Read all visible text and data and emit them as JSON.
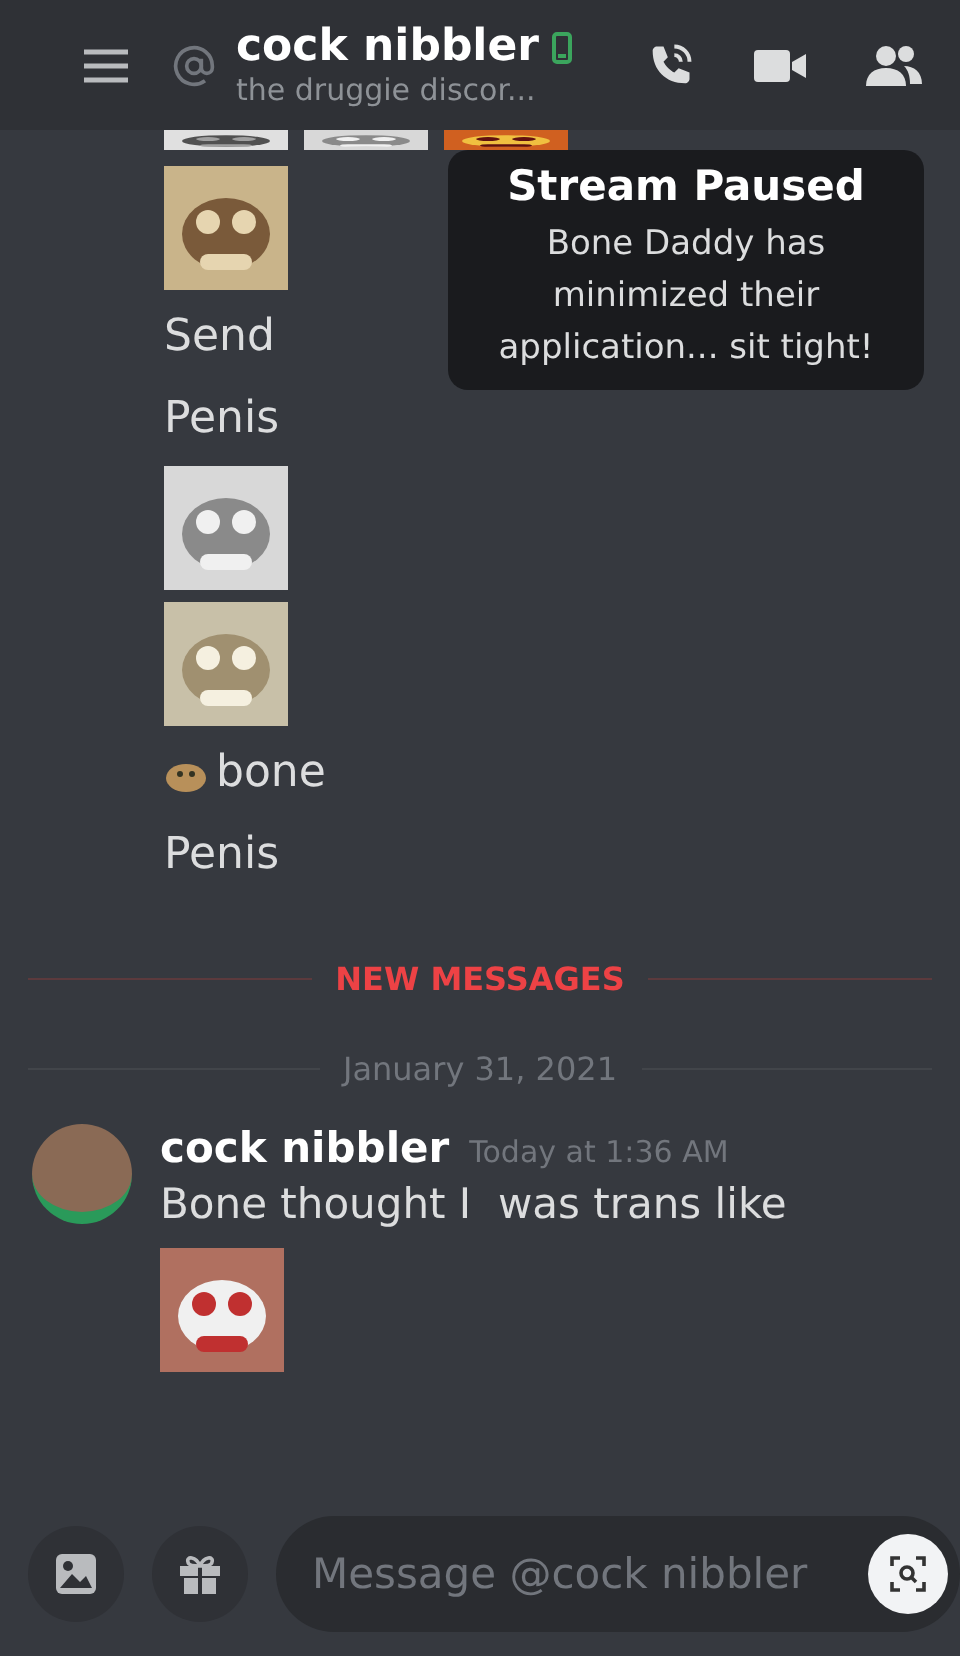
{
  "header": {
    "title": "cock nibbler",
    "subtitle": "the druggie discor..."
  },
  "stream_overlay": {
    "title": "Stream Paused",
    "text": "Bone Daddy has minimized their application... sit tight!"
  },
  "feed": [
    {
      "kind": "picture_strip"
    },
    {
      "kind": "picture"
    },
    {
      "kind": "text",
      "text": "Send"
    },
    {
      "kind": "text",
      "text": "Penis"
    },
    {
      "kind": "picture"
    },
    {
      "kind": "picture"
    },
    {
      "kind": "emoji_text",
      "text": "bone"
    },
    {
      "kind": "text",
      "text": "Penis"
    }
  ],
  "new_messages_divider": {
    "label": "NEW MESSAGES"
  },
  "date_divider": {
    "label": "January 31, 2021"
  },
  "message": {
    "author": "cock nibbler",
    "time": "Today at 1:36 AM",
    "text": "Bone thought I  was trans like",
    "attachment": {
      "kind": "picture"
    }
  },
  "composer": {
    "placeholder": "Message @cock nibbler"
  }
}
